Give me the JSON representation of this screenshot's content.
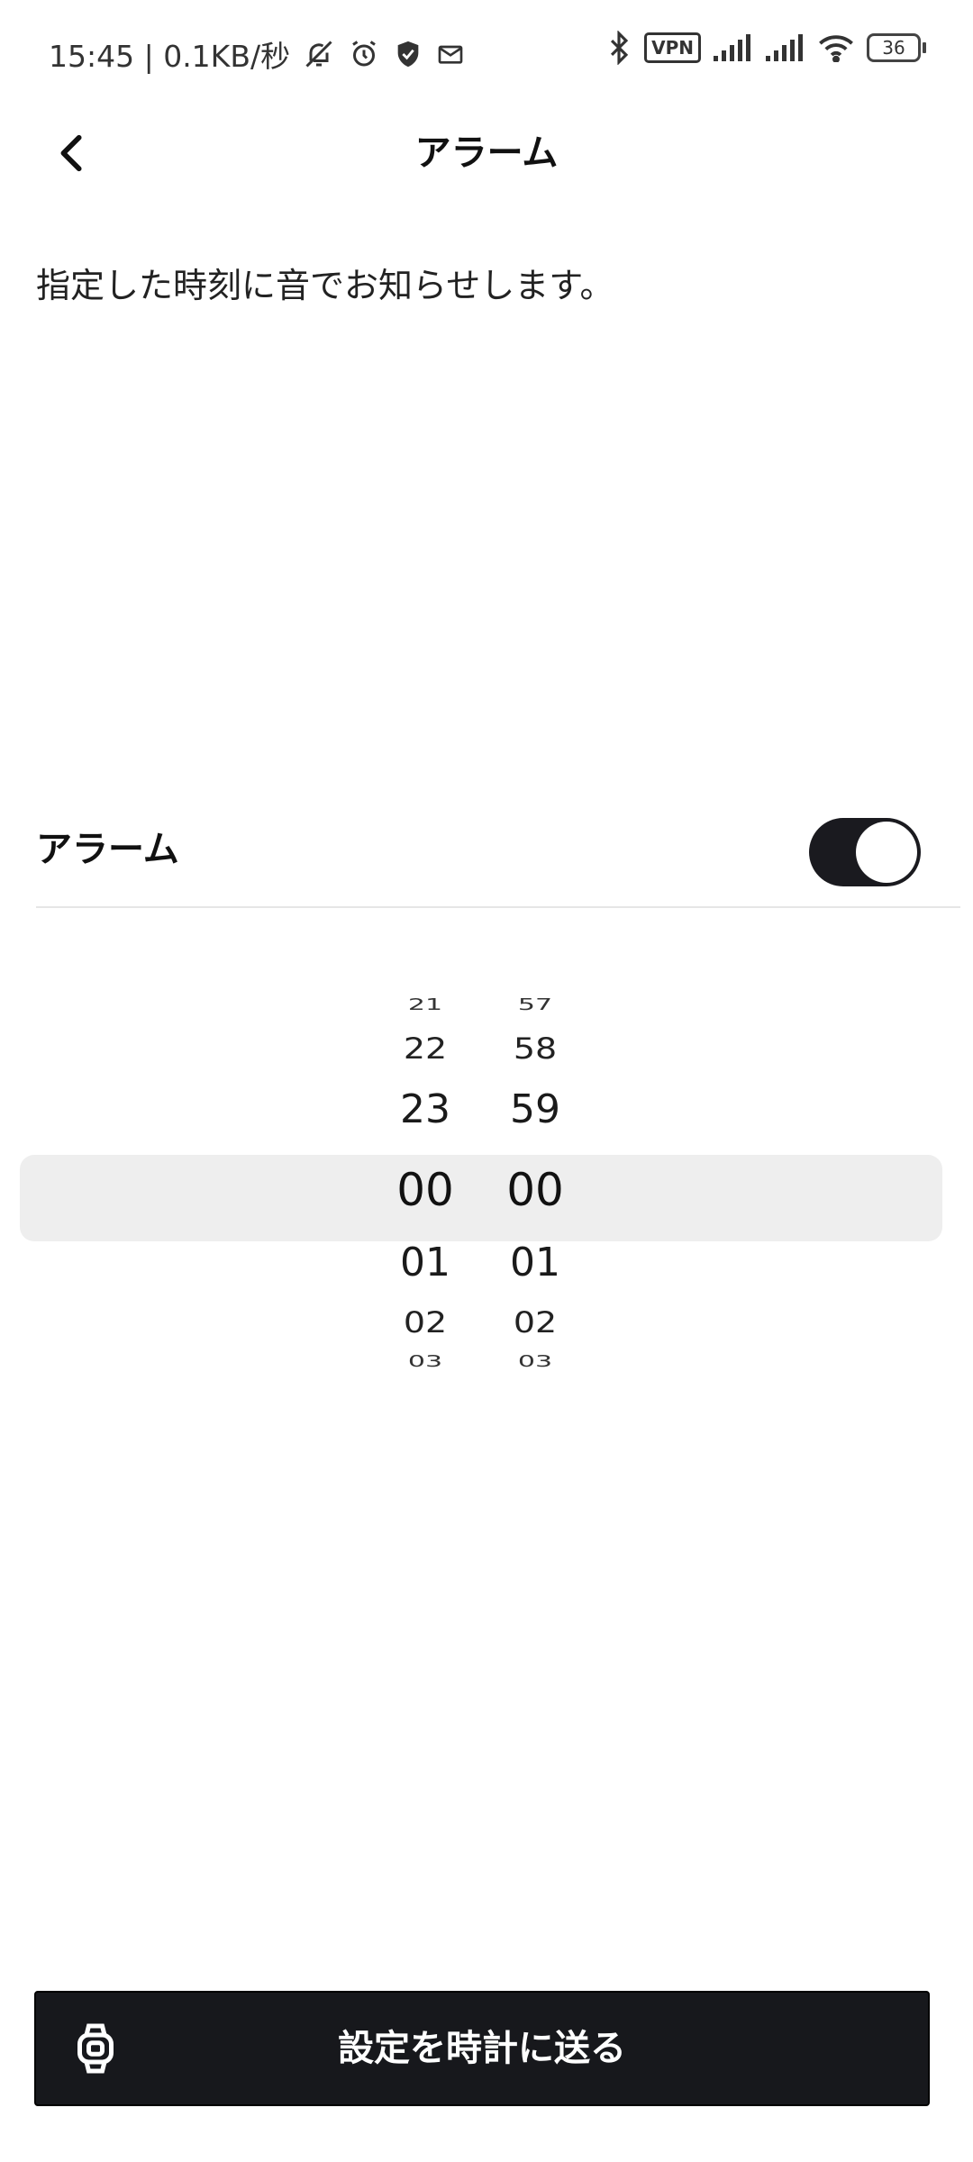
{
  "status_bar": {
    "time_speed": "15:45 | 0.1KB/秒",
    "vpn": "VPN",
    "battery": "36"
  },
  "header": {
    "title": "アラーム"
  },
  "description": "指定した時刻に音でお知らせします。",
  "alarm": {
    "label": "アラーム",
    "enabled": true
  },
  "picker": {
    "hours": [
      "21",
      "22",
      "23",
      "00",
      "01",
      "02",
      "03"
    ],
    "minutes": [
      "57",
      "58",
      "59",
      "00",
      "01",
      "02",
      "03"
    ],
    "selected_hour": "00",
    "selected_minute": "00"
  },
  "send_button": {
    "label": "設定を時計に送る"
  }
}
